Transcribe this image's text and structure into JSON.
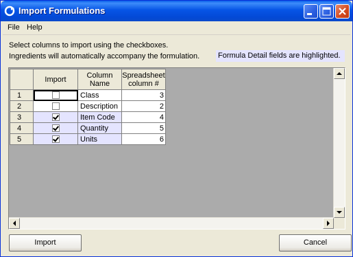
{
  "window": {
    "title": "Import Formulations"
  },
  "menu": [
    {
      "label": "File"
    },
    {
      "label": "Help"
    }
  ],
  "instructions": {
    "line1": "Select columns to import using the checkboxes.",
    "line2": "Ingredients will automatically accompany the formulation.",
    "highlight_note": "Formula Detail fields are highlighted."
  },
  "grid": {
    "headers": {
      "import": "Import",
      "column_name": "Column Name",
      "spreadsheet_column": "Spreadsheet column #"
    },
    "rows": [
      {
        "num": "1",
        "checked": false,
        "name": "Class",
        "col": "3",
        "highlighted": false
      },
      {
        "num": "2",
        "checked": false,
        "name": "Description",
        "col": "2",
        "highlighted": false
      },
      {
        "num": "3",
        "checked": true,
        "name": "Item Code",
        "col": "4",
        "highlighted": true
      },
      {
        "num": "4",
        "checked": true,
        "name": "Quantity",
        "col": "5",
        "highlighted": true
      },
      {
        "num": "5",
        "checked": true,
        "name": "Units",
        "col": "6",
        "highlighted": true
      }
    ]
  },
  "buttons": {
    "import": "Import",
    "cancel": "Cancel"
  },
  "colors": {
    "highlight": "#E4E4FF",
    "titlebar": "#0755E6",
    "dialog_bg": "#ECE9D8"
  }
}
